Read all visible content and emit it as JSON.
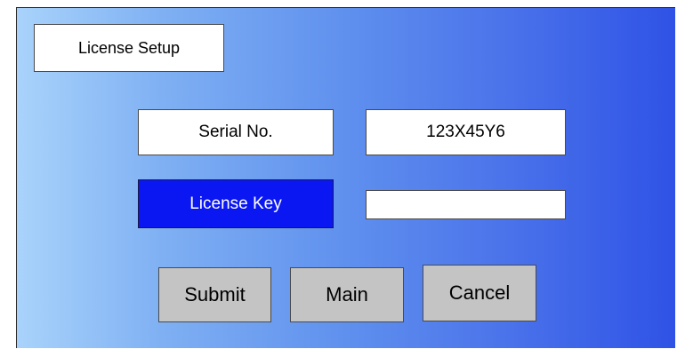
{
  "dialog": {
    "title": "License Setup"
  },
  "form": {
    "serial_label": "Serial No.",
    "serial_value": "123X45Y6",
    "license_label": "License Key",
    "license_value": ""
  },
  "buttons": {
    "submit": "Submit",
    "main": "Main",
    "cancel": "Cancel"
  },
  "colors": {
    "background_left": "#a9d3fb",
    "background_right": "#2f52e6",
    "highlight": "#0a17f3",
    "button": "#c4c4c4"
  }
}
